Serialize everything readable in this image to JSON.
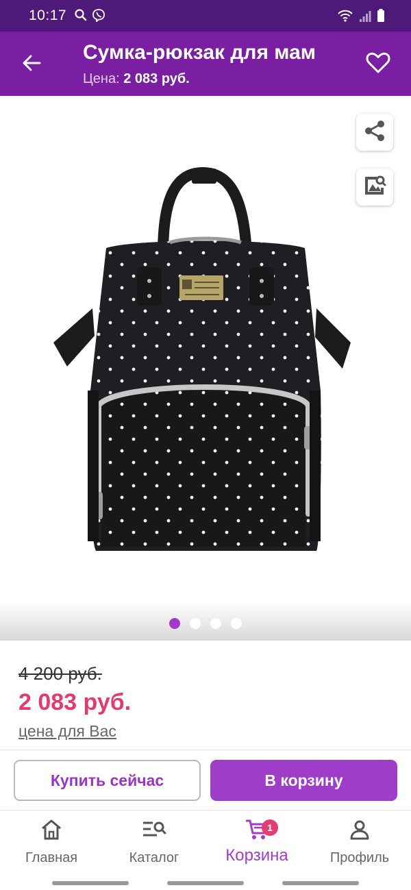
{
  "status_bar": {
    "time": "10:17"
  },
  "app_bar": {
    "title": "Сумка-рюкзак для мам",
    "price_label": "Цена:",
    "price_value": "2 083 руб."
  },
  "gallery": {
    "image_count": 4,
    "active_index": 0
  },
  "pricing": {
    "old_price": "4 200 руб.",
    "new_price": "2 083 руб.",
    "note": "цена для Вас"
  },
  "actions": {
    "buy_now": "Купить сейчас",
    "add_to_cart": "В корзину"
  },
  "bottom_nav": {
    "items": [
      {
        "label": "Главная",
        "icon": "home-icon"
      },
      {
        "label": "Каталог",
        "icon": "catalog-search-icon"
      },
      {
        "label": "Корзина",
        "icon": "cart-icon",
        "badge": "1",
        "active": true
      },
      {
        "label": "Профиль",
        "icon": "profile-icon"
      }
    ]
  },
  "colors": {
    "status_bar": "#4e1a7a",
    "app_bar": "#7a1fa2",
    "accent": "#a03dc8",
    "price": "#e23c6d",
    "badge": "#e43d74"
  }
}
